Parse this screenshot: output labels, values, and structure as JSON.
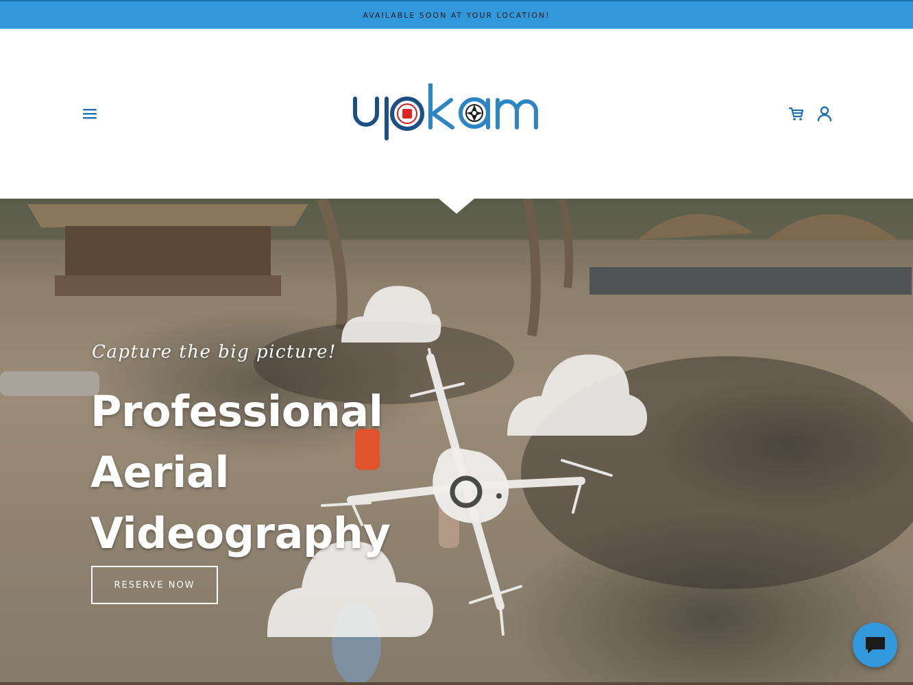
{
  "announcement": {
    "text": "AVAILABLE SOON AT YOUR LOCATION!"
  },
  "header": {
    "menu_icon": "hamburger-menu-icon",
    "logo_text": "upkam",
    "cart_icon": "shopping-cart-icon",
    "account_icon": "user-account-icon"
  },
  "hero": {
    "tagline": "Capture the big picture!",
    "headline_lines": [
      "Professional",
      "Aerial",
      "Videography"
    ],
    "cta_label": "RESERVE NOW"
  },
  "chat": {
    "icon": "chat-bubble-icon"
  },
  "colors": {
    "accent": "#3298dc",
    "logo_dark": "#1b4f86",
    "logo_light": "#2c86c6",
    "logo_red": "#e02424",
    "icon_blue": "#1f6fb0"
  }
}
